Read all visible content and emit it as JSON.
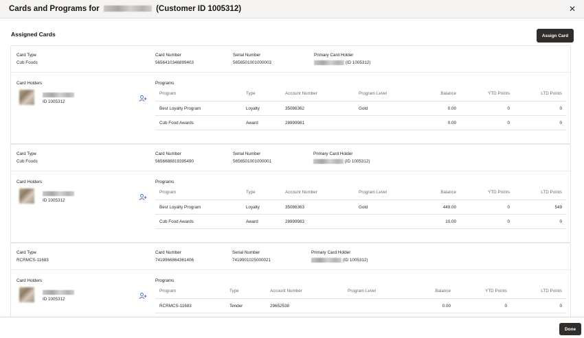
{
  "dialog": {
    "title_prefix": "Cards and Programs for",
    "title_suffix": "(Customer ID 1005312)",
    "close_icon": "close-icon",
    "done_label": "Done"
  },
  "assigned": {
    "title": "Assigned Cards",
    "assign_label": "Assign Card"
  },
  "labels": {
    "card_type": "Card Type",
    "card_number": "Card Number",
    "serial_number": "Serial Number",
    "primary_holder": "Primary Card Holder",
    "card_holders": "Card Holders",
    "programs": "Programs",
    "col_program": "Program",
    "col_type": "Type",
    "col_account": "Account Number",
    "col_level": "Program Level",
    "col_balance": "Balance",
    "col_ytd": "YTD Points",
    "col_ltd": "LTD Points"
  },
  "cards": [
    {
      "card_type": "Cub Foods",
      "card_number": "5656410346899403",
      "serial_number": "5656501001000003",
      "primary_holder_id": "(ID 1005312)",
      "holder_id": "ID 1005312",
      "programs": [
        {
          "program": "Best Loyalty Program",
          "type": "Loyalty",
          "account": "35086362",
          "level": "Gold",
          "balance": "0.00",
          "ytd": "0",
          "ltd": "0"
        },
        {
          "program": "Cub Food Awards",
          "type": "Award",
          "account": "28999981",
          "level": "",
          "balance": "0.00",
          "ytd": "0",
          "ltd": "0"
        }
      ]
    },
    {
      "card_type": "Cub Foods",
      "card_number": "5656688819395490",
      "serial_number": "5656501001000001",
      "primary_holder_id": "(ID 1005312)",
      "holder_id": "ID 1005312",
      "programs": [
        {
          "program": "Best Loyalty Program",
          "type": "Loyalty",
          "account": "35086363",
          "level": "Gold",
          "balance": "449.00",
          "ytd": "0",
          "ltd": "549"
        },
        {
          "program": "Cub Food Awards",
          "type": "Award",
          "account": "28999983",
          "level": "",
          "balance": "10.00",
          "ytd": "0",
          "ltd": "0"
        }
      ]
    },
    {
      "card_type": "RCRMCS-11683",
      "card_number": "7419966864361406",
      "serial_number": "7419901025000021",
      "primary_holder_id": "(ID 1005312)",
      "holder_id": "ID 1005312",
      "programs": [
        {
          "program": "RCRMCS-11683",
          "type": "Tender",
          "account": "29652538",
          "level": "",
          "balance": "0.00",
          "ytd": "0",
          "ltd": "0"
        }
      ]
    }
  ]
}
